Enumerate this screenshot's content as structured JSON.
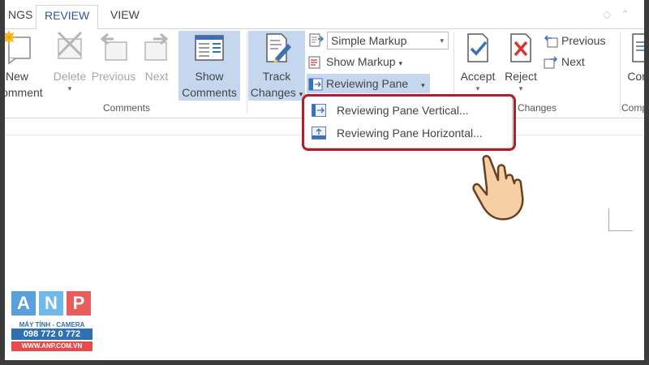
{
  "tabs": {
    "ings": "NGS",
    "review": "REVIEW",
    "view": "VIEW"
  },
  "comments_group": {
    "new_line1": "New",
    "new_line2": "Comment",
    "delete": "Delete",
    "previous": "Previous",
    "next": "Next",
    "show_line1": "Show",
    "show_line2": "Comments",
    "label": "Comments"
  },
  "tracking_group": {
    "track_line1": "Track",
    "track_line2": "Changes",
    "markup_combo": "Simple Markup",
    "show_markup": "Show Markup",
    "reviewing_pane": "Reviewing Pane"
  },
  "changes_group": {
    "accept": "Accept",
    "reject": "Reject",
    "previous": "Previous",
    "next": "Next",
    "label": "Changes"
  },
  "compare_group": {
    "button": "Comp",
    "label": "Comp"
  },
  "reviewing_pane_menu": {
    "vertical": "Reviewing Pane Vertical...",
    "horizontal": "Reviewing Pane Horizontal..."
  },
  "logo": {
    "letters": [
      "A",
      "N",
      "P"
    ],
    "tagline": "MÁY TÍNH - CAMERA",
    "phone": "098 772 0 772",
    "website": "WWW.ANP.COM.VN"
  },
  "colors": {
    "accent": "#2b579a",
    "selected_bg": "#c5d7ef",
    "highlight_ring": "#b01e2a",
    "logo_blue": "#2f6fb3",
    "logo_red": "#e84a4a"
  }
}
